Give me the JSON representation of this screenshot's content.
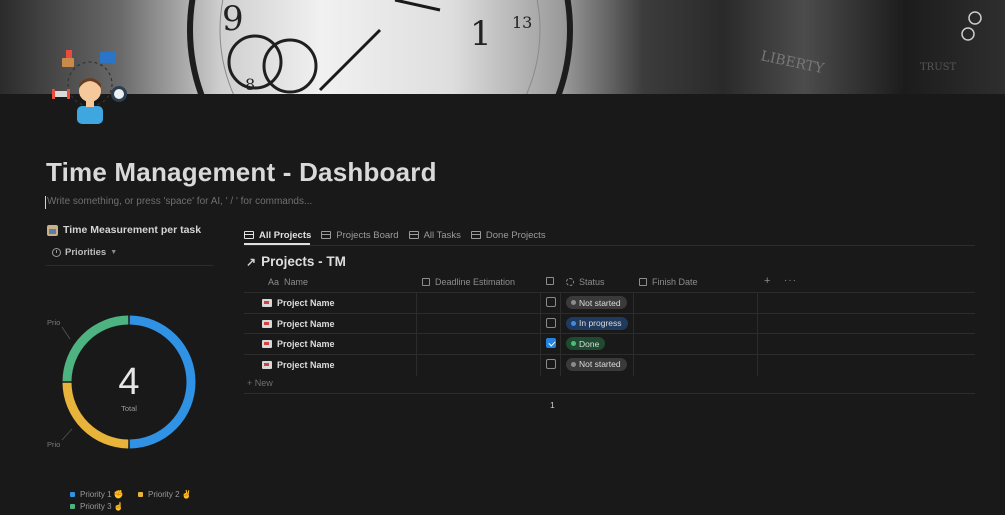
{
  "page": {
    "title": "Time Management - Dashboard",
    "command_placeholder": "Write something, or press 'space' for AI, ' / ' for commands..."
  },
  "chart_panel": {
    "title": "Time Measurement per task",
    "group_by_label": "Priorities",
    "callout_top": "Prio",
    "callout_bottom": "Prio",
    "center_value": "4",
    "center_label": "Total"
  },
  "chart_data": {
    "type": "pie",
    "title": "Time Measurement per task",
    "total": 4,
    "center_label": "Total",
    "slices": [
      {
        "name": "Priority 1 ✊",
        "value": 2,
        "color": "#2f92e4"
      },
      {
        "name": "Priority 2 ✌",
        "value": 1,
        "color": "#e8b33a"
      },
      {
        "name": "Priority 3 ☝",
        "value": 1,
        "color": "#4db380"
      }
    ]
  },
  "tabs": [
    {
      "label": "All Projects",
      "active": true
    },
    {
      "label": "Projects Board",
      "active": false
    },
    {
      "label": "All Tasks",
      "active": false
    },
    {
      "label": "Done Projects",
      "active": false
    }
  ],
  "database": {
    "title": "Projects - TM",
    "columns": {
      "name": "Name",
      "name_prefix": "Aa",
      "deadline": "Deadline Estimation",
      "status": "Status",
      "finish": "Finish Date"
    },
    "rows": [
      {
        "name": "Project Name",
        "done": false,
        "status": "Not started"
      },
      {
        "name": "Project Name",
        "done": false,
        "status": "In progress"
      },
      {
        "name": "Project Name",
        "done": true,
        "status": "Done"
      },
      {
        "name": "Project Name",
        "done": false,
        "status": "Not started"
      }
    ],
    "new_label": "+ New",
    "count": "1"
  },
  "status_colors": {
    "Not started": {
      "bg": "#3a3a3a",
      "dot": "#8c8c8c"
    },
    "In progress": {
      "bg": "#1f3a5c",
      "dot": "#3a8ee6"
    },
    "Done": {
      "bg": "#1e4a30",
      "dot": "#4dbb7a"
    }
  }
}
